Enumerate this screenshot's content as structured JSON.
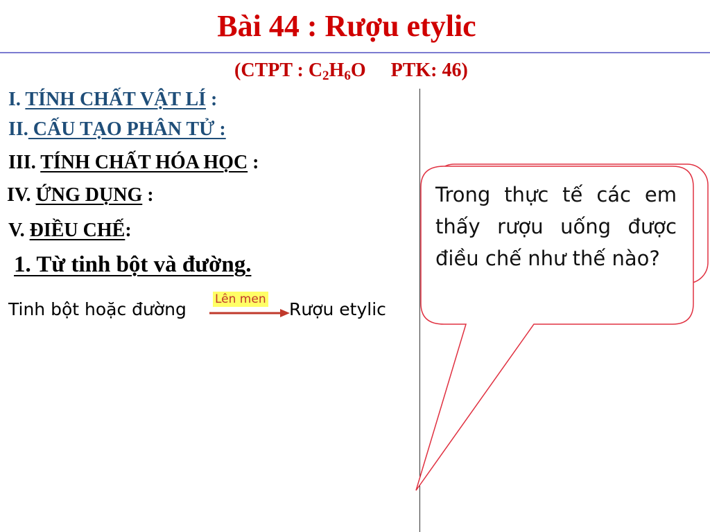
{
  "title": "Bài 44 : Rượu etylic",
  "formula": {
    "open": "(CTPT : C",
    "sub1": "2",
    "mid": "H",
    "sub2": "6",
    "end": "O",
    "ptk": "PTK:  46)"
  },
  "sections": [
    {
      "num": "I. ",
      "label": "TÍNH CHẤT VẬT LÍ",
      "suffix": " :"
    },
    {
      "num": "II.",
      "label": " CẤU TẠO PHÂN TỬ :",
      "suffix": ""
    },
    {
      "num": "III. ",
      "label": "TÍNH CHẤT HÓA HỌC",
      "suffix": " :"
    },
    {
      "num": "IV. ",
      "label": "ỨNG DỤNG",
      "suffix": " :"
    },
    {
      "num": "V. ",
      "label": "ĐIỀU CHẾ",
      "suffix": ":"
    }
  ],
  "sub_heading": "1. Từ tinh bột và đường.",
  "reaction": {
    "reactant": "Tinh bột hoặc đường",
    "condition": "Lên men",
    "product": "Rượu etylic"
  },
  "callout": {
    "text": "Trong thực tế các em thấy rượu uống được điều chế như thế nào?"
  },
  "colors": {
    "title": "#d00000",
    "section_blue": "#1f4e79",
    "callout_border": "#e03040",
    "arrow": "#c0392b"
  }
}
